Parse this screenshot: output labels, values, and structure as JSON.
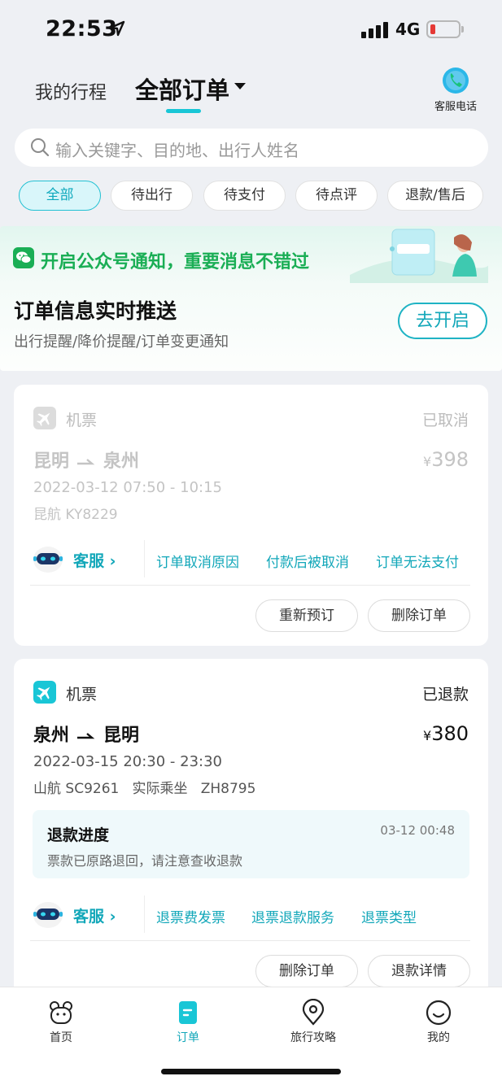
{
  "status_bar": {
    "time": "22:53",
    "network": "4G"
  },
  "header": {
    "tab_trip": "我的行程",
    "tab_all": "全部订单",
    "cs_phone_label": "客服电话"
  },
  "search": {
    "placeholder": "输入关键字、目的地、出行人姓名"
  },
  "filters": [
    "全部",
    "待出行",
    "待支付",
    "待点评",
    "退款/售后"
  ],
  "promo": {
    "title": "开启公众号通知，重要消息不错过",
    "heading": "订单信息实时推送",
    "subtitle": "出行提醒/降价提醒/订单变更通知",
    "button": "去开启"
  },
  "orders": [
    {
      "kind": "机票",
      "status": "已取消",
      "from": "昆明",
      "to": "泉州",
      "currency": "¥",
      "price": "398",
      "time": "2022-03-12 07:50 - 10:15",
      "flight": "昆航 KY8229",
      "cs_label": "客服",
      "cs_links": [
        "订单取消原因",
        "付款后被取消",
        "订单无法支付"
      ],
      "buttons": [
        "重新预订",
        "删除订单"
      ]
    },
    {
      "kind": "机票",
      "status": "已退款",
      "from": "泉州",
      "to": "昆明",
      "currency": "¥",
      "price": "380",
      "time": "2022-03-15 20:30 - 23:30",
      "flight": "山航 SC9261   实际乘坐   ZH8795",
      "refund": {
        "title": "退款进度",
        "time": "03-12 00:48",
        "desc": "票款已原路退回，请注意查收退款"
      },
      "cs_label": "客服",
      "cs_links": [
        "退票费发票",
        "退票退款服务",
        "退票类型"
      ],
      "buttons": [
        "删除订单",
        "退款详情"
      ]
    }
  ],
  "tabbar": [
    "首页",
    "订单",
    "旅行攻略",
    "我的"
  ],
  "colors": {
    "accent": "#19c6d6",
    "wechat_green": "#1aae55",
    "muted": "#c4c4c4"
  }
}
